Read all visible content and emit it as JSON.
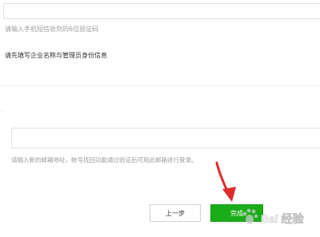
{
  "verification": {
    "code_value": "",
    "code_hint": "请输入手机短信收到的6位验证码"
  },
  "enterprise": {
    "section_title": "请先填写企业名称与管理员身份信息"
  },
  "email": {
    "side_mark": "·",
    "value": "",
    "hint": "请输入新的邮箱地址，帐号找回功能通过验证后可用此邮箱进行登录。"
  },
  "actions": {
    "prev_label": "上一步",
    "finish_label": "完成"
  },
  "annotation": {
    "arrow_color": "#e02b2b",
    "arrow_icon": "red-arrow-icon"
  },
  "watermark": {
    "text": "Bai 经验",
    "icon": "paw-icon"
  },
  "colors": {
    "primary": "#1aad19",
    "hint": "#9b9b9b",
    "border": "#e2e2e2"
  }
}
